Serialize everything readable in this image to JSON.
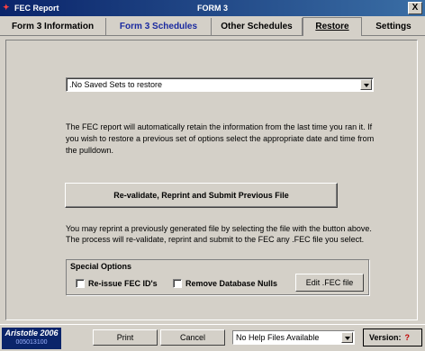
{
  "window": {
    "app_title": "FEC Report",
    "form_title": "FORM 3",
    "close_label": "X"
  },
  "tabs": [
    {
      "label": "Form 3 Information"
    },
    {
      "label": "Form 3 Schedules"
    },
    {
      "label": "Other Schedules"
    },
    {
      "label": "Restore"
    },
    {
      "label": "Settings"
    }
  ],
  "restore": {
    "saved_sets_value": ".No Saved Sets to restore",
    "info_text": "The FEC report will automatically retain the information from the last time you ran it. If you wish to restore a previous set of options select the appropriate date and time from the pulldown.",
    "revalidate_button": "Re-validate, Reprint and Submit Previous File",
    "reprint_text": "You may reprint a previously generated file by selecting the file with the button above.  The process will re-validate, reprint and submit to the FEC any .FEC file you select."
  },
  "special_options": {
    "legend": "Special Options",
    "reissue_label": "Re-issue FEC ID's",
    "remove_nulls_label": "Remove Database Nulls",
    "edit_button": "Edit .FEC file"
  },
  "footer": {
    "brand_name": "Aristotle 2006",
    "brand_code": "005013100",
    "print_button": "Print",
    "cancel_button": "Cancel",
    "help_select_value": "No Help Files Available",
    "version_label": "Version:",
    "version_icon": "?"
  },
  "colors": {
    "titlebar": "#0a246a",
    "window_bg": "#d4d0c8",
    "active_tab_text": "#1a2aa0"
  }
}
